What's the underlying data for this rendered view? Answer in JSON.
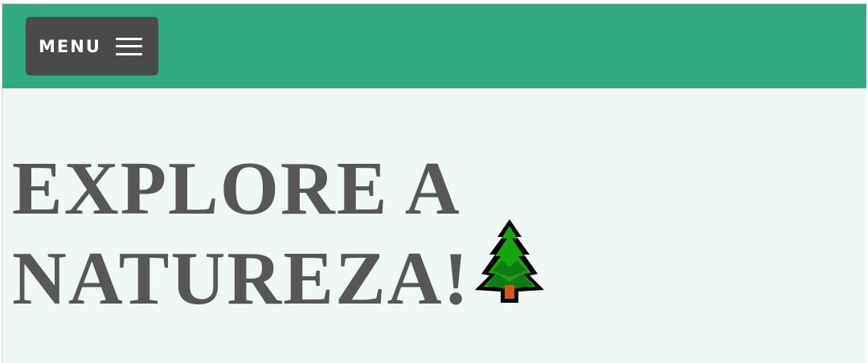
{
  "header": {
    "menu_label": "MENU",
    "menu_icon": "hamburger-icon",
    "background_color": "#30aa7e"
  },
  "hero": {
    "title_line_1": "EXPLORE A",
    "title_line_2": "NATUREZA!",
    "title_icon": "evergreen-tree-icon",
    "title_color": "#575757"
  },
  "colors": {
    "page_background": "#eff8f5",
    "menu_button_background": "#4a4a4a"
  }
}
